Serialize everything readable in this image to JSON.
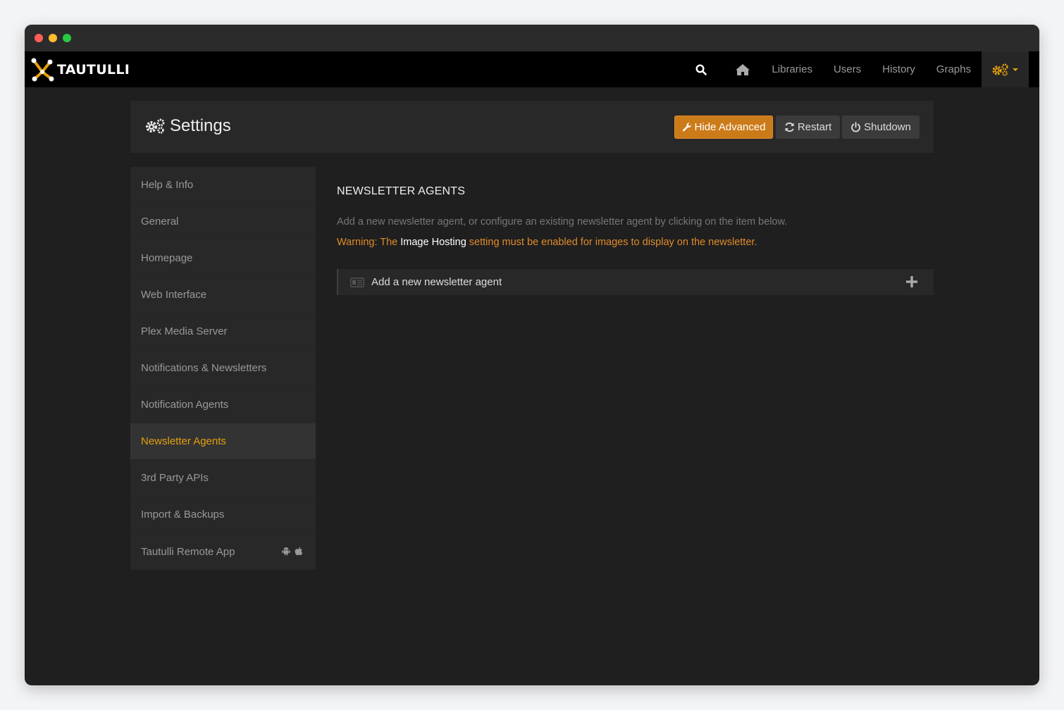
{
  "app": {
    "brand": "TAUTULLI"
  },
  "navbar": {
    "items": [
      {
        "label": "Libraries"
      },
      {
        "label": "Users"
      },
      {
        "label": "History"
      },
      {
        "label": "Graphs"
      }
    ]
  },
  "header": {
    "title": "Settings",
    "buttons": {
      "advanced": "Hide Advanced",
      "restart": "Restart",
      "shutdown": "Shutdown"
    }
  },
  "sidebar": {
    "items": [
      {
        "label": "Help & Info"
      },
      {
        "label": "General"
      },
      {
        "label": "Homepage"
      },
      {
        "label": "Web Interface"
      },
      {
        "label": "Plex Media Server"
      },
      {
        "label": "Notifications & Newsletters"
      },
      {
        "label": "Notification Agents"
      },
      {
        "label": "Newsletter Agents",
        "active": true
      },
      {
        "label": "3rd Party APIs"
      },
      {
        "label": "Import & Backups"
      },
      {
        "label": "Tautulli Remote App"
      }
    ]
  },
  "main": {
    "section_title": "NEWSLETTER AGENTS",
    "description": "Add a new newsletter agent, or configure an existing newsletter agent by clicking on the item below.",
    "warning_prefix": "Warning: The ",
    "warning_highlight": "Image Hosting",
    "warning_suffix": " setting must be enabled for images to display on the newsletter.",
    "add_agent_label": "Add a new newsletter agent"
  },
  "colors": {
    "accent": "#e5a00d",
    "button_orange": "#cc7b19",
    "warning": "#e08b2a",
    "background": "#1f1f1f",
    "panel": "#282828"
  }
}
